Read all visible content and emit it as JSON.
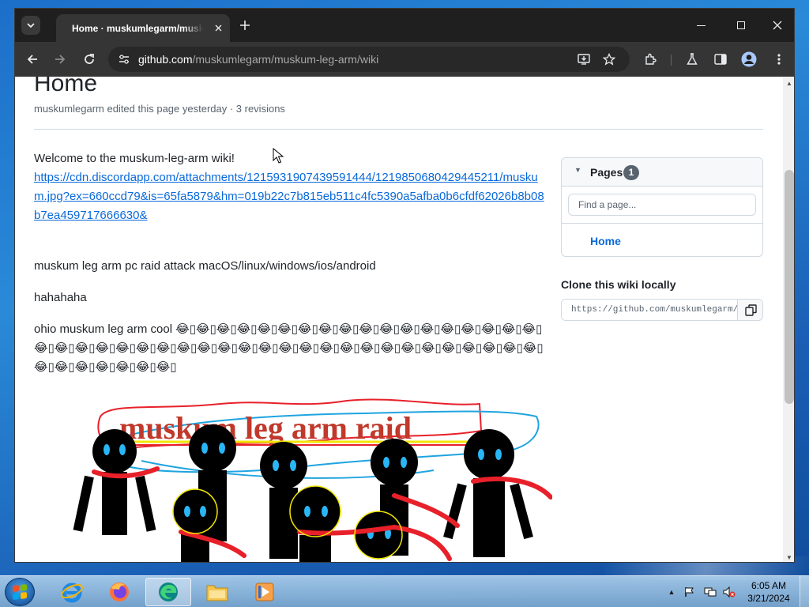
{
  "browser": {
    "tab_title": "Home · muskumlegarm/muskum-leg-arm Wiki",
    "url_host": "github.com",
    "url_path": "/muskumlegarm/muskum-leg-arm/wiki"
  },
  "wiki": {
    "title": "Home",
    "meta": "muskumlegarm edited this page yesterday · 3 revisions",
    "welcome": "Welcome to the muskum-leg-arm wiki!",
    "link": "https://cdn.discordapp.com/attachments/1215931907439591444/1219850680429445211/muskum.jpg?ex=660ccd79&is=65fa5879&hm=019b22c7b815eb511c4fc5390a5afba0b6cfdf62026b8b08b7ea459717666630&",
    "attack": "muskum leg arm pc raid attack macOS/linux/windows/ios/android",
    "haha": "hahahaha",
    "ohio": "ohio muskum leg arm cool 😂▯😂▯😂▯😂▯😂▯😂▯😂▯😂▯😂▯😂▯😂▯😂▯😂▯😂▯😂▯😂▯😂▯😂▯😂▯😂▯😂▯😂▯😂▯😂▯😂▯😂▯😂▯😂▯😂▯😂▯😂▯😂▯😂▯😂▯😂▯😂▯😂▯😂▯😂▯😂▯😂▯😂▯😂▯😂▯😂▯😂▯😂▯😂▯😂▯😂▯",
    "image_caption": "muskum leg arm raid"
  },
  "sidebar": {
    "pages_label": "Pages",
    "pages_count": "1",
    "find_placeholder": "Find a page...",
    "pages": [
      "Home"
    ],
    "clone_title": "Clone this wiki locally",
    "clone_url": "https://github.com/muskumlegarm/muskum-leg-arm.wiki.git"
  },
  "taskbar": {
    "time": "6:05 AM",
    "date": "3/21/2024"
  },
  "colors": {
    "link": "#0969da",
    "text": "#1f2328",
    "muted": "#59636e",
    "chrome_dark": "#1f1f1f"
  }
}
